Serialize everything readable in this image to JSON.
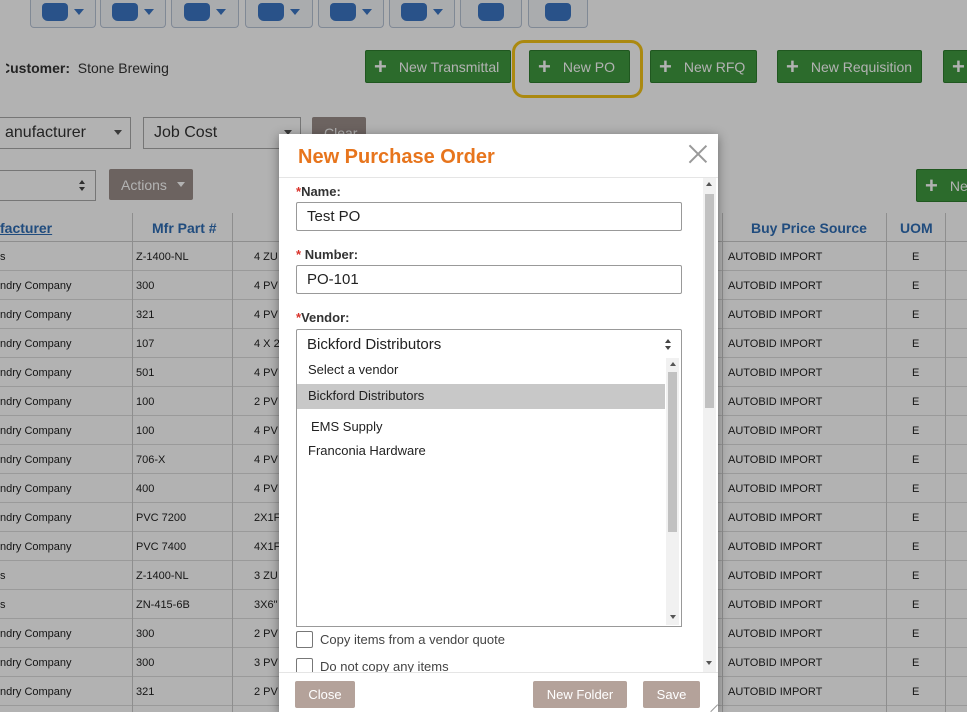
{
  "customer": {
    "label": "Customer:",
    "value": "Stone Brewing"
  },
  "actions": {
    "new_transmittal": "New Transmittal",
    "new_po": "New PO",
    "new_rfq": "New RFQ",
    "new_requisition": "New Requisition"
  },
  "filters": {
    "manufacturer_value": "anufacturer",
    "cost_type_value": "Job Cost",
    "clear_label": "Clear",
    "actions_label": "Actions"
  },
  "grid": {
    "columns": {
      "manufacturer": "facturer",
      "mfr_part": "Mfr Part #",
      "buy_price_source": "Buy Price Source",
      "uom": "UOM"
    },
    "rows": [
      {
        "mfr": "s",
        "part": "Z-1400-NL",
        "desc": "4 ZU",
        "source": "AUTOBID IMPORT",
        "uom": "E"
      },
      {
        "mfr": "ndry Company",
        "part": "300",
        "desc": "4 PV",
        "source": "AUTOBID IMPORT",
        "uom": "E"
      },
      {
        "mfr": "ndry Company",
        "part": "321",
        "desc": "4 PV",
        "source": "AUTOBID IMPORT",
        "uom": "E"
      },
      {
        "mfr": "ndry Company",
        "part": "107",
        "desc": "4 X 2",
        "source": "AUTOBID IMPORT",
        "uom": "E"
      },
      {
        "mfr": "ndry Company",
        "part": "501",
        "desc": "4 PV",
        "source": "AUTOBID IMPORT",
        "uom": "E"
      },
      {
        "mfr": "ndry Company",
        "part": "100",
        "desc": "2 PV",
        "source": "AUTOBID IMPORT",
        "uom": "E"
      },
      {
        "mfr": "ndry Company",
        "part": "100",
        "desc": "4 PV",
        "source": "AUTOBID IMPORT",
        "uom": "E"
      },
      {
        "mfr": "ndry Company",
        "part": "706-X",
        "desc": "4 PV",
        "source": "AUTOBID IMPORT",
        "uom": "E"
      },
      {
        "mfr": "ndry Company",
        "part": "400",
        "desc": "4 PV",
        "source": "AUTOBID IMPORT",
        "uom": "E"
      },
      {
        "mfr": "ndry Company",
        "part": "PVC 7200",
        "desc": "2X1F",
        "source": "AUTOBID IMPORT",
        "uom": "E"
      },
      {
        "mfr": "ndry Company",
        "part": "PVC 7400",
        "desc": "4X1F",
        "source": "AUTOBID IMPORT",
        "uom": "E"
      },
      {
        "mfr": "s",
        "part": "Z-1400-NL",
        "desc": "3 ZU",
        "source": "AUTOBID IMPORT",
        "uom": "E"
      },
      {
        "mfr": "s",
        "part": "ZN-415-6B",
        "desc": "3X6\"",
        "source": "AUTOBID IMPORT",
        "uom": "E"
      },
      {
        "mfr": "ndry Company",
        "part": "300",
        "desc": "2 PV",
        "source": "AUTOBID IMPORT",
        "uom": "E"
      },
      {
        "mfr": "ndry Company",
        "part": "300",
        "desc": "3 PV",
        "source": "AUTOBID IMPORT",
        "uom": "E"
      },
      {
        "mfr": "ndry Company",
        "part": "321",
        "desc": "2 PV",
        "source": "AUTOBID IMPORT",
        "uom": "E"
      }
    ]
  },
  "modal": {
    "title": "New Purchase Order",
    "name_label": "Name:",
    "name_value": "Test PO",
    "number_label": "Number:",
    "number_value": "PO-101",
    "vendor_label": "Vendor:",
    "vendor_selected": "Bickford Distributors",
    "vendor_options": [
      "Select a vendor",
      "Bickford Distributors",
      "EMS Supply",
      "Franconia Hardware"
    ],
    "copy_vendor_quote": "Copy items from a vendor quote",
    "do_not_copy": "Do not copy any items",
    "close": "Close",
    "new_folder": "New Folder",
    "save": "Save"
  },
  "colors": {
    "accent_orange": "#e7751d",
    "green_button": "#3f9a3f",
    "highlight": "#f5c518",
    "link_blue": "#2f6db5"
  }
}
